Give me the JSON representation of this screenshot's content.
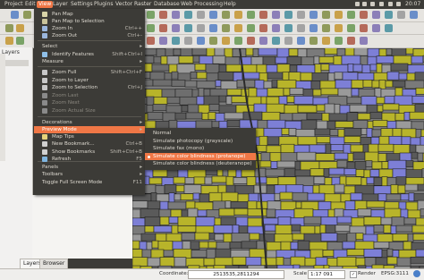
{
  "menubar": {
    "items": [
      "Project",
      "Edit",
      "View",
      "Layer",
      "Settings",
      "Plugins",
      "Vector",
      "Raster",
      "Database",
      "Web",
      "Processing",
      "Help"
    ],
    "clock": "20:07"
  },
  "view_menu": {
    "items": [
      {
        "label": "Pan Map",
        "shortcut": "",
        "icon": true
      },
      {
        "label": "Pan Map to Selection",
        "shortcut": "",
        "icon": true
      },
      {
        "label": "Zoom In",
        "shortcut": "Ctrl++",
        "icon": true
      },
      {
        "label": "Zoom Out",
        "shortcut": "Ctrl+-",
        "icon": true
      },
      {
        "label": "Select",
        "shortcut": "",
        "submenu": true
      },
      {
        "label": "Identify Features",
        "shortcut": "Shift+Ctrl+I",
        "icon": true
      },
      {
        "label": "Measure",
        "shortcut": "",
        "submenu": true
      },
      {
        "label": "Zoom Full",
        "shortcut": "Shift+Ctrl+F",
        "icon": true
      },
      {
        "label": "Zoom to Layer",
        "shortcut": "",
        "icon": true
      },
      {
        "label": "Zoom to Selection",
        "shortcut": "Ctrl+J",
        "icon": true
      },
      {
        "label": "Zoom Last",
        "shortcut": "",
        "icon": true,
        "disabled": true
      },
      {
        "label": "Zoom Next",
        "shortcut": "",
        "icon": true,
        "disabled": true
      },
      {
        "label": "Zoom Actual Size",
        "shortcut": "",
        "icon": true,
        "disabled": true
      },
      {
        "label": "Decorations",
        "shortcut": "",
        "submenu": true
      },
      {
        "label": "Preview Mode",
        "shortcut": "",
        "submenu": true,
        "highlight": true
      },
      {
        "label": "Map Tips",
        "shortcut": "",
        "icon": true
      },
      {
        "label": "New Bookmark...",
        "shortcut": "Ctrl+B",
        "icon": true
      },
      {
        "label": "Show Bookmarks",
        "shortcut": "Shift+Ctrl+B",
        "icon": true
      },
      {
        "label": "Refresh",
        "shortcut": "F5",
        "icon": true
      },
      {
        "label": "Panels",
        "shortcut": "",
        "submenu": true
      },
      {
        "label": "Toolbars",
        "shortcut": "",
        "submenu": true
      },
      {
        "label": "Toggle Full Screen Mode",
        "shortcut": "F11",
        "icon": false
      }
    ]
  },
  "preview_submenu": {
    "items": [
      {
        "label": "Normal",
        "selected": false
      },
      {
        "label": "Simulate photocopy (grayscale)",
        "selected": false
      },
      {
        "label": "Simulate fax (mono)",
        "selected": false
      },
      {
        "label": "Simulate color blindness (protanope)",
        "selected": true
      },
      {
        "label": "Simulate color blindness (deuteranope)",
        "selected": false
      }
    ]
  },
  "left_panel": {
    "title": "Layers",
    "tabs": [
      "Layers",
      "Browser"
    ]
  },
  "statusbar": {
    "coordinate_label": "Coordinate:",
    "coordinate_value": "2513535,2811294",
    "scale_label": "Scale",
    "scale_value": "1:17 091",
    "render_label": "Render",
    "crs": "EPSG:3111"
  },
  "colors": {
    "accent": "#f07746",
    "map_yellow": "#b8b42a",
    "map_blue": "#7d7fd6",
    "map_gray": "#7a7a7a"
  }
}
